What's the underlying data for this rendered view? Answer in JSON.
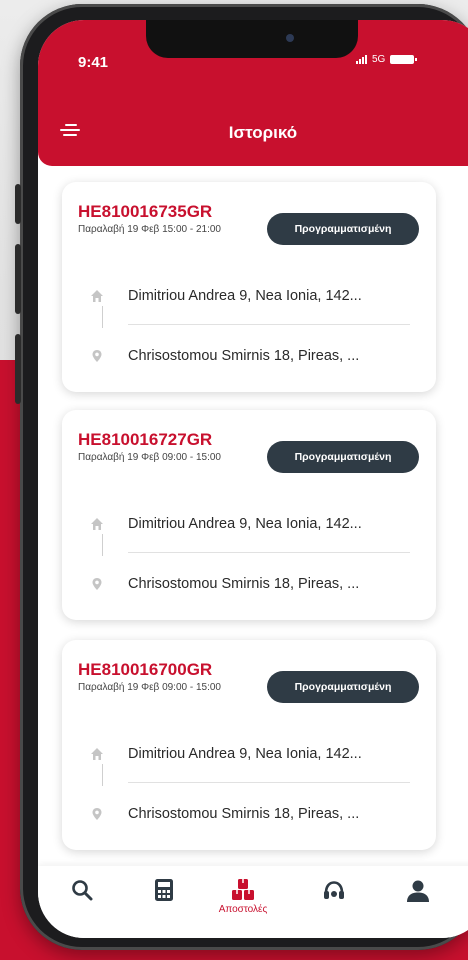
{
  "status_bar": {
    "time": "9:41",
    "network": "5G"
  },
  "header": {
    "title": "Ιστορικό"
  },
  "shipments": [
    {
      "tracking": "HE810016735GR",
      "pickup": "Παραλαβή 19 Φεβ 15:00 - 21:00",
      "status": "Προγραμματισμένη",
      "from": "Dimitriou Andrea 9, Nea Ionia, 142...",
      "to": "Chrisostomou Smirnis 18, Pireas, ..."
    },
    {
      "tracking": "HE810016727GR",
      "pickup": "Παραλαβή 19 Φεβ 09:00 - 15:00",
      "status": "Προγραμματισμένη",
      "from": "Dimitriou Andrea 9, Nea Ionia, 142...",
      "to": "Chrisostomou Smirnis 18, Pireas, ..."
    },
    {
      "tracking": "HE810016700GR",
      "pickup": "Παραλαβή 19 Φεβ 09:00 - 15:00",
      "status": "Προγραμματισμένη",
      "from": "Dimitriou Andrea 9, Nea Ionia, 142...",
      "to": "Chrisostomou Smirnis 18, Pireas, ..."
    }
  ],
  "tabbar": {
    "items": [
      {
        "icon": "search-icon"
      },
      {
        "icon": "calculator-icon"
      },
      {
        "icon": "boxes-icon",
        "label": "Αποστολές",
        "active": true
      },
      {
        "icon": "headset-icon"
      },
      {
        "icon": "user-icon"
      }
    ]
  },
  "colors": {
    "brand": "#c8102e",
    "badge": "#2f3b45",
    "icon_gray": "#c5c5c5"
  }
}
